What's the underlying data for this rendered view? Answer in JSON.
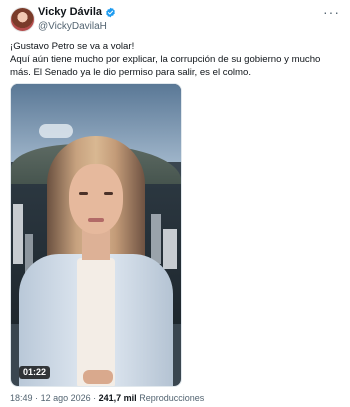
{
  "author": {
    "display_name": "Vicky Dávila",
    "handle": "@VickyDavilaH",
    "verified": true,
    "verified_color": "#1d9bf0",
    "more_icon": "more-horizontal-icon"
  },
  "tweet": {
    "text": "¡Gustavo Petro se va a volar!\nAquí aún tiene mucho por explicar, la corrupción de su gobierno y mucho más. El Senado ya le dio permiso para salir, es el colmo."
  },
  "video": {
    "duration": "01:22"
  },
  "meta": {
    "time": "18:49",
    "separator1": "·",
    "date": "12 ago 2026",
    "separator2": "·",
    "views_count": "241,7 mil",
    "views_label": "Reproducciones"
  }
}
